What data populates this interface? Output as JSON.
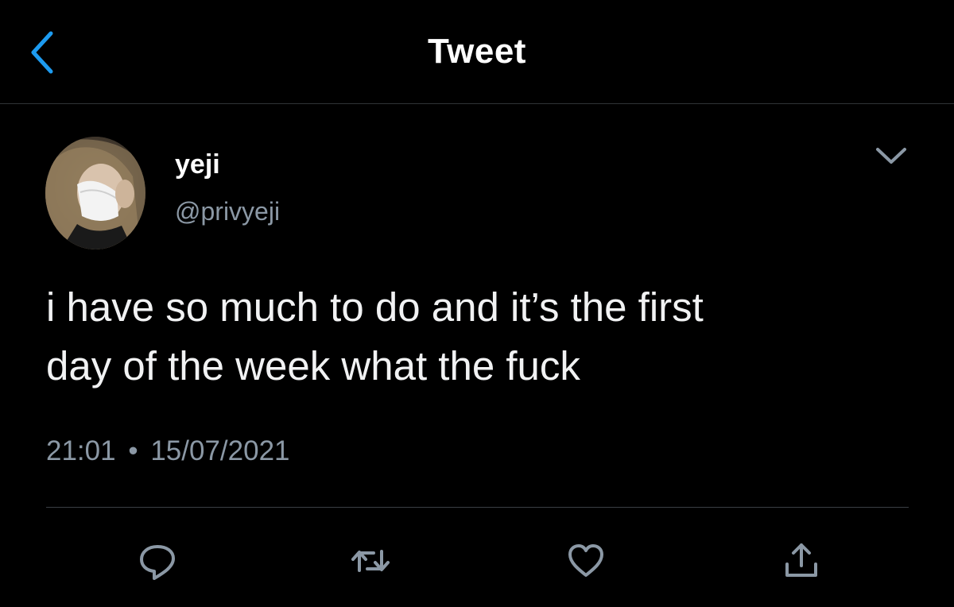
{
  "header": {
    "title": "Tweet",
    "back_icon": "chevron-left-icon",
    "accent_color": "#1d9bf0"
  },
  "tweet": {
    "display_name": "yeji",
    "handle": "@privyeji",
    "text_line1": "i have so much to do and it’s the first",
    "text_line2": "day of the week what the fuck",
    "time": "21:01",
    "separator": "•",
    "date": "15/07/2021",
    "more_icon": "chevron-down-icon"
  },
  "actions": [
    {
      "icon": "reply-icon"
    },
    {
      "icon": "retweet-icon"
    },
    {
      "icon": "like-icon"
    },
    {
      "icon": "share-icon"
    }
  ],
  "colors": {
    "background": "#000000",
    "text_primary": "#ffffff",
    "text_secondary": "#8b98a5",
    "divider": "#2f3336"
  }
}
